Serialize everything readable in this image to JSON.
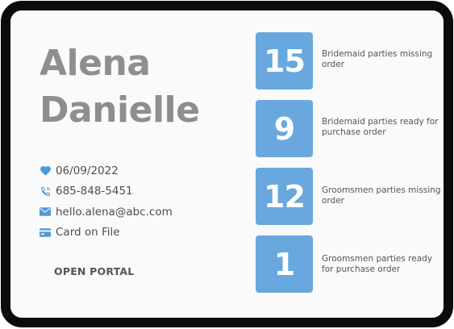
{
  "profile": {
    "first_name": "Alena",
    "last_name": "Danielle",
    "date": "06/09/2022",
    "phone": "685-848-5451",
    "email": "hello.alena@abc.com",
    "payment": "Card on File",
    "portal_button": "OPEN PORTAL"
  },
  "stats": [
    {
      "value": "15",
      "label": "Bridemaid parties missing order"
    },
    {
      "value": "9",
      "label": "Bridemaid parties ready for purchase order"
    },
    {
      "value": "12",
      "label": "Groomsmen parties missing order"
    },
    {
      "value": "1",
      "label": "Groomsmen parties ready for purchase order"
    }
  ],
  "icons": {
    "date": "heart-icon",
    "phone": "phone-icon",
    "email": "mail-icon",
    "payment": "credit-card-icon"
  },
  "colors": {
    "accent": "#68a8df",
    "name_text": "#8e8e8e",
    "frame": "#0b0b0b"
  }
}
